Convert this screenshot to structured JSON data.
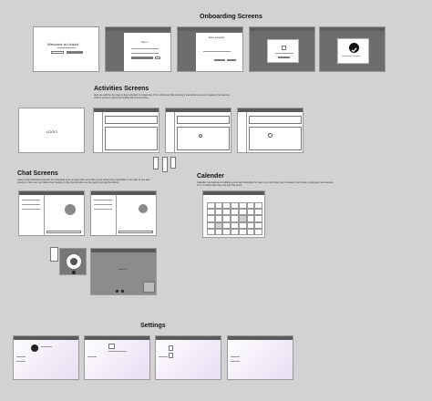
{
  "sections": {
    "onboarding": "Onboarding Screens",
    "activities": "Activities Screens",
    "chat": "Chat Screens",
    "calender": "Calender",
    "settings": "Settings"
  },
  "descriptions": {
    "activities": "Here we add the fun (day to day) activities to create lots of fun which are fully keeping it interactive as a tool, however the features work to prevent users from feeling left out and alone.",
    "chat": "Users could individual chat with the individual ones to each other and other users (when) they would like to are able to see and receive it. Also user can follow their favorite in the chat will also see the (sent) and call the History.",
    "calender": "Calender has features of adding events and reminders for users not much they want to attend it and other employees have access to it, on which date they can see that event."
  },
  "onboarding": {
    "welcome_title": "Welcome to Linked",
    "login_title": "Sign In",
    "password_title": "Reset password",
    "verification_title": "Verification Complete"
  },
  "activities": {
    "logo": "LOGO"
  },
  "chat": {
    "video_label": "Video Call"
  },
  "colors": {
    "background": "#d2d2d2",
    "frame_dark": "#6d6d6d",
    "titlebar": "#5a5a5a",
    "settings_tint": "#efe7f6"
  }
}
